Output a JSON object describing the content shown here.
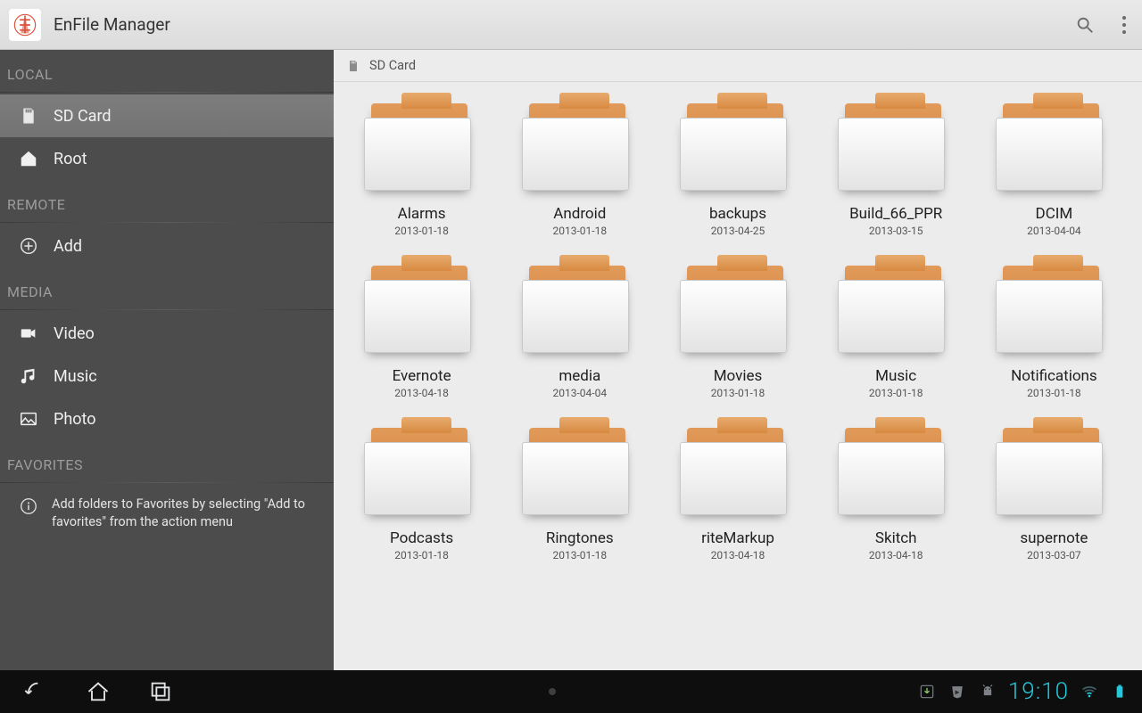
{
  "app": {
    "title": "EnFile Manager"
  },
  "action_bar": {
    "search_icon": "search",
    "overflow_icon": "more-vert"
  },
  "sidebar": {
    "sections": {
      "local": {
        "label": "LOCAL",
        "items": [
          {
            "id": "sdcard",
            "label": "SD Card",
            "icon": "sd-card",
            "active": true
          },
          {
            "id": "root",
            "label": "Root",
            "icon": "home"
          }
        ]
      },
      "remote": {
        "label": "REMOTE",
        "items": [
          {
            "id": "add-remote",
            "label": "Add",
            "icon": "plus-circle"
          }
        ]
      },
      "media": {
        "label": "MEDIA",
        "items": [
          {
            "id": "video",
            "label": "Video",
            "icon": "video"
          },
          {
            "id": "music",
            "label": "Music",
            "icon": "music"
          },
          {
            "id": "photo",
            "label": "Photo",
            "icon": "photo"
          }
        ]
      },
      "favorites": {
        "label": "FAVORITES",
        "hint": "Add folders to Favorites by selecting \"Add to favorites\" from the action menu"
      }
    }
  },
  "breadcrumb": {
    "label": "SD Card"
  },
  "folders": [
    {
      "name": "Alarms",
      "date": "2013-01-18"
    },
    {
      "name": "Android",
      "date": "2013-01-18"
    },
    {
      "name": "backups",
      "date": "2013-04-25"
    },
    {
      "name": "Build_66_PPR",
      "date": "2013-03-15"
    },
    {
      "name": "DCIM",
      "date": "2013-04-04"
    },
    {
      "name": "Evernote",
      "date": "2013-04-18"
    },
    {
      "name": "media",
      "date": "2013-04-04"
    },
    {
      "name": "Movies",
      "date": "2013-01-18"
    },
    {
      "name": "Music",
      "date": "2013-01-18"
    },
    {
      "name": "Notifications",
      "date": "2013-01-18"
    },
    {
      "name": "Podcasts",
      "date": "2013-01-18"
    },
    {
      "name": "Ringtones",
      "date": "2013-01-18"
    },
    {
      "name": "riteMarkup",
      "date": "2013-04-18"
    },
    {
      "name": "Skitch",
      "date": "2013-04-18"
    },
    {
      "name": "supernote",
      "date": "2013-03-07"
    }
  ],
  "system": {
    "clock": "19:10",
    "nav": {
      "back": "back",
      "home": "home",
      "recent": "recent"
    },
    "tray": [
      "download",
      "play-store",
      "android",
      "wifi",
      "battery"
    ]
  }
}
